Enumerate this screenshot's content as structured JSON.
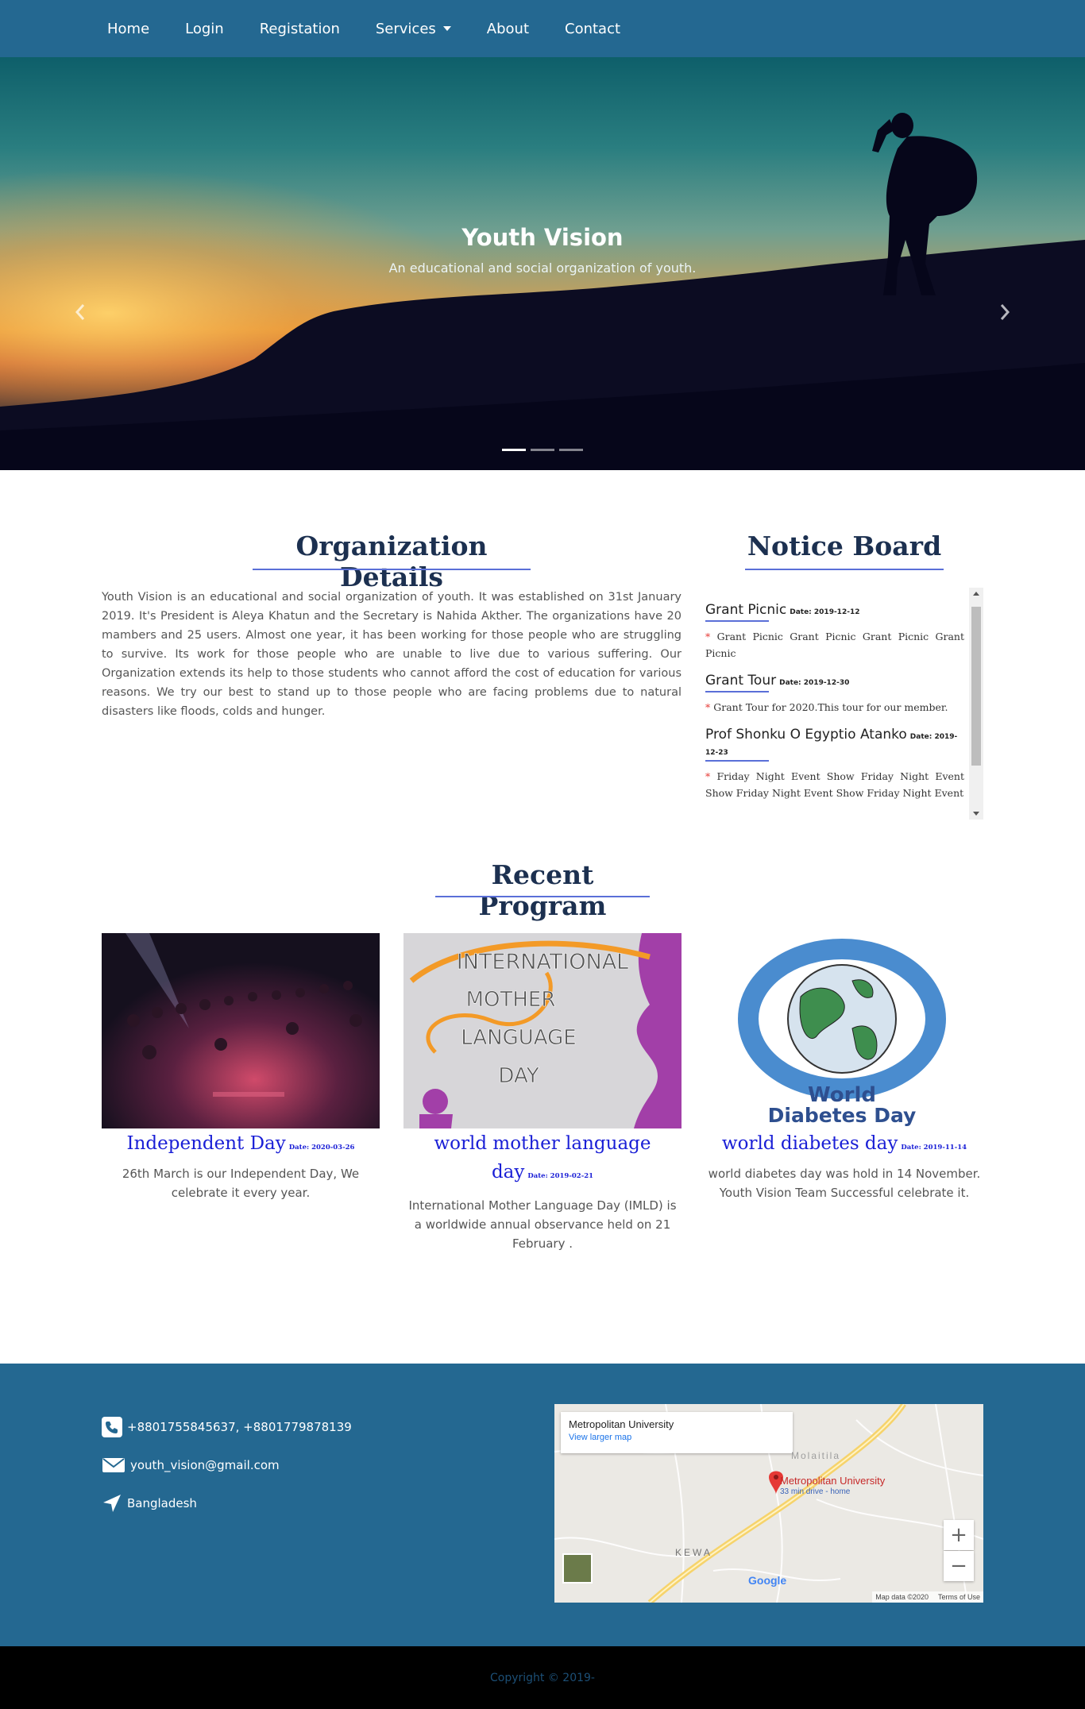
{
  "nav": {
    "items": [
      "Home",
      "Login",
      "Registation",
      "Services",
      "About",
      "Contact"
    ]
  },
  "hero": {
    "title": "Youth Vision",
    "subtitle": "An educational and social organization of youth.",
    "slide_count": 3,
    "active_slide": 1
  },
  "organization": {
    "title": "Organization Details",
    "text": "Youth Vision is an educational and social organization of youth. It was established on 31st January 2019. It's President is Aleya Khatun and the Secretary is Nahida Akther. The organizations have 20 mambers and 25 users. Almost one year, it has been working for those people who are struggling to survive. Its work for those people who are unable to live due to various suffering. Our Organization extends its help to those students who cannot afford the cost of education for various reasons. We try our best to stand up to those people who are facing problems due to natural disasters like floods, colds and hunger."
  },
  "notice": {
    "title": "Notice Board",
    "items": [
      {
        "title": "Grant Picnic",
        "date": "Date: 2019-12-12",
        "body": "Grant Picnic Grant Picnic Grant Picnic Grant Picnic"
      },
      {
        "title": "Grant Tour",
        "date": "Date: 2019-12-30",
        "body": "Grant Tour for 2020.This tour for our member."
      },
      {
        "title": "Prof Shonku O Egyptio Atanko",
        "date": "Date: 2019-12-23",
        "body": "Friday Night Event Show Friday Night Event Show Friday Night Event Show Friday Night Event"
      }
    ]
  },
  "recent": {
    "title": "Recent Program",
    "cards": [
      {
        "title": "Independent Day",
        "date": "Date: 2020-03-26",
        "text": "26th March is our Independent Day, We celebrate it every year."
      },
      {
        "title": "world mother language day",
        "date": "Date: 2019-02-21",
        "text": "International Mother Language Day (IMLD) is a worldwide annual observance held on 21 February .",
        "image_text": [
          "INTERNATIONAL",
          "MOTHER",
          "LANGUAGE",
          "DAY"
        ]
      },
      {
        "title": "world diabetes day",
        "date": "Date: 2019-11-14",
        "text": "world diabetes day was hold in 14 November. Youth Vision Team Successful celebrate it.",
        "image_text": [
          "World",
          "Diabetes Day"
        ]
      }
    ]
  },
  "footer": {
    "phone": "+8801755845637, +8801779878139",
    "email": "youth_vision@gmail.com",
    "location": "Bangladesh",
    "icons": [
      "phone-icon",
      "envelope-icon",
      "location-arrow-icon"
    ]
  },
  "map": {
    "place": "Metropolitan University",
    "view_larger": "View larger map",
    "pin_label": "Metropolitan University",
    "pin_sub": "33 min drive - home",
    "area_labels": [
      "Molaitila",
      "KEWA"
    ],
    "data_credit": "Map data ©2020",
    "terms": "Terms of Use",
    "brand": "Google"
  },
  "copyright": "Copyright © 2019-",
  "colors": {
    "nav": "#246891",
    "heading": "#1c3050",
    "accent": "#5a6fd8",
    "link": "#1a1fd6",
    "footer": "#246891"
  }
}
